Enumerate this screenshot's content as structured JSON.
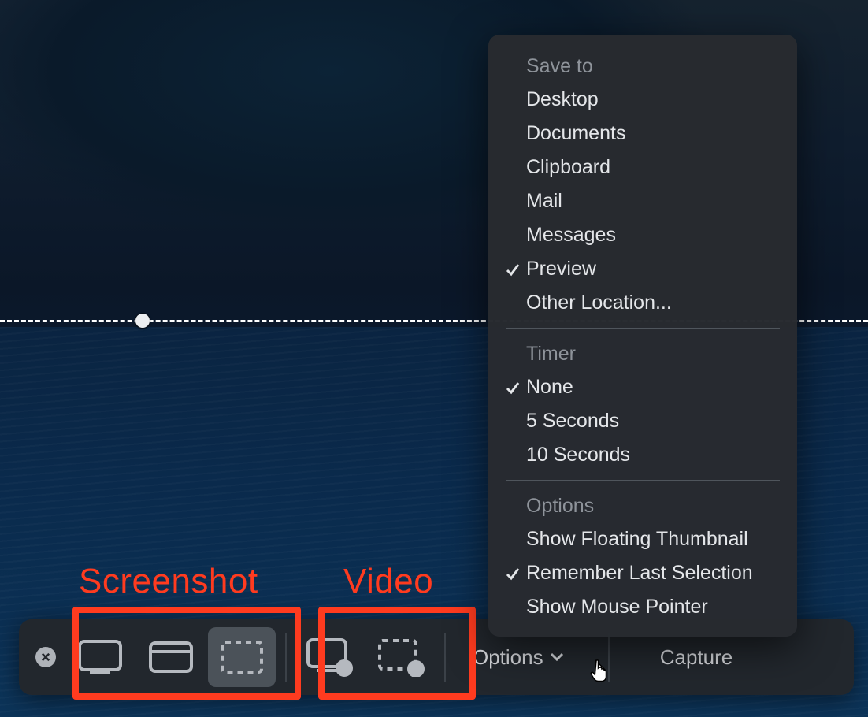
{
  "annotations": {
    "screenshot_label": "Screenshot",
    "video_label": "Video"
  },
  "toolbar": {
    "options_label": "Options",
    "capture_label": "Capture"
  },
  "options_menu": {
    "save_to": {
      "title": "Save to",
      "items": [
        "Desktop",
        "Documents",
        "Clipboard",
        "Mail",
        "Messages",
        "Preview",
        "Other Location..."
      ],
      "checked_index": 5
    },
    "timer": {
      "title": "Timer",
      "items": [
        "None",
        "5 Seconds",
        "10 Seconds"
      ],
      "checked_index": 0
    },
    "options": {
      "title": "Options",
      "items": [
        "Show Floating Thumbnail",
        "Remember Last Selection",
        "Show Mouse Pointer"
      ],
      "checked_indices": [
        1
      ]
    }
  }
}
